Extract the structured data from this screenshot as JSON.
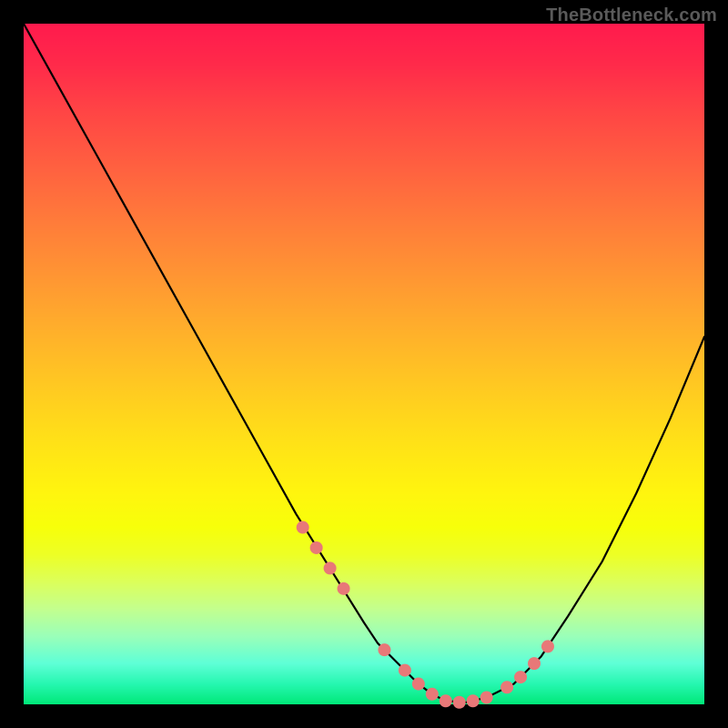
{
  "watermark": "TheBottleneck.com",
  "chart_data": {
    "type": "line",
    "title": "",
    "xlabel": "",
    "ylabel": "",
    "xlim": [
      0,
      100
    ],
    "ylim": [
      0,
      100
    ],
    "series": [
      {
        "name": "curve",
        "x": [
          0,
          5,
          10,
          15,
          20,
          25,
          30,
          35,
          40,
          45,
          50,
          52,
          55,
          58,
          60,
          62,
          65,
          68,
          72,
          76,
          80,
          85,
          90,
          95,
          100
        ],
        "y": [
          100,
          91,
          82,
          73,
          64,
          55,
          46,
          37,
          28,
          20,
          12,
          9,
          6,
          3,
          1.5,
          0.5,
          0.3,
          1,
          3,
          7,
          13,
          21,
          31,
          42,
          54
        ]
      }
    ],
    "markers": {
      "name": "dots",
      "color": "#e87878",
      "radius_px": 7,
      "x": [
        41,
        43,
        45,
        47,
        53,
        56,
        58,
        60,
        62,
        64,
        66,
        68,
        71,
        73,
        75,
        77
      ],
      "y": [
        26,
        23,
        20,
        17,
        8,
        5,
        3,
        1.5,
        0.5,
        0.3,
        0.5,
        1,
        2.5,
        4,
        6,
        8.5
      ]
    }
  }
}
